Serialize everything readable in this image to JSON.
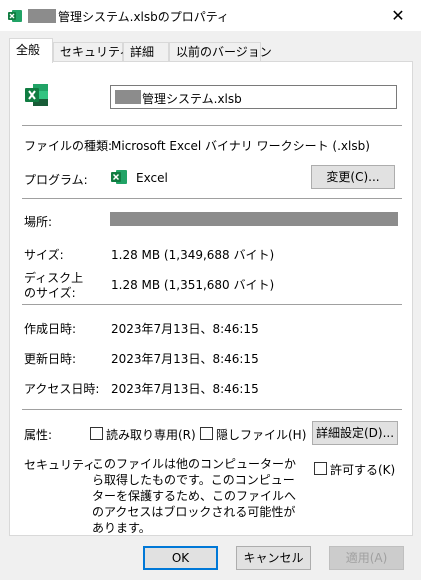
{
  "window": {
    "title": "管理システム.xlsbのプロパティ",
    "close_symbol": "✕"
  },
  "tabs": [
    {
      "label": "全般",
      "active": true
    },
    {
      "label": "セキュリティ",
      "active": false
    },
    {
      "label": "詳細",
      "active": false
    },
    {
      "label": "以前のバージョン",
      "active": false
    }
  ],
  "general": {
    "file_name": "管理システム.xlsb",
    "file_type_label": "ファイルの種類:",
    "file_type_value": "Microsoft Excel バイナリ ワークシート (.xlsb)",
    "program_label": "プログラム:",
    "program_value": "Excel",
    "change_button": "変更(C)...",
    "location_label": "場所:",
    "size_label": "サイズ:",
    "size_value": "1.28 MB (1,349,688 バイト)",
    "disk_size_label_1": "ディスク上",
    "disk_size_label_2": "のサイズ:",
    "disk_size_value": "1.28 MB (1,351,680 バイト)",
    "created_label": "作成日時:",
    "created_value": "2023年7月13日、8:46:15",
    "modified_label": "更新日時:",
    "modified_value": "2023年7月13日、8:46:15",
    "accessed_label": "アクセス日時:",
    "accessed_value": "2023年7月13日、8:46:15",
    "attributes_label": "属性:",
    "readonly_label": "読み取り専用(R)",
    "hidden_label": "隠しファイル(H)",
    "advanced_button": "詳細設定(D)...",
    "security_label": "セキュリティ:",
    "security_text": "このファイルは他のコンピューターから取得したものです。このコンピューターを保護するため、このファイルへのアクセスはブロックされる可能性があります。",
    "allow_label": "許可する(K)"
  },
  "footer": {
    "ok": "OK",
    "cancel": "キャンセル",
    "apply": "適用(A)"
  },
  "colors": {
    "excel_green": "#107c41",
    "focus_blue": "#0078d7",
    "redaction_gray": "#8c8c8c"
  },
  "icons": [
    "excel-icon",
    "close-icon",
    "checkbox-icon"
  ]
}
